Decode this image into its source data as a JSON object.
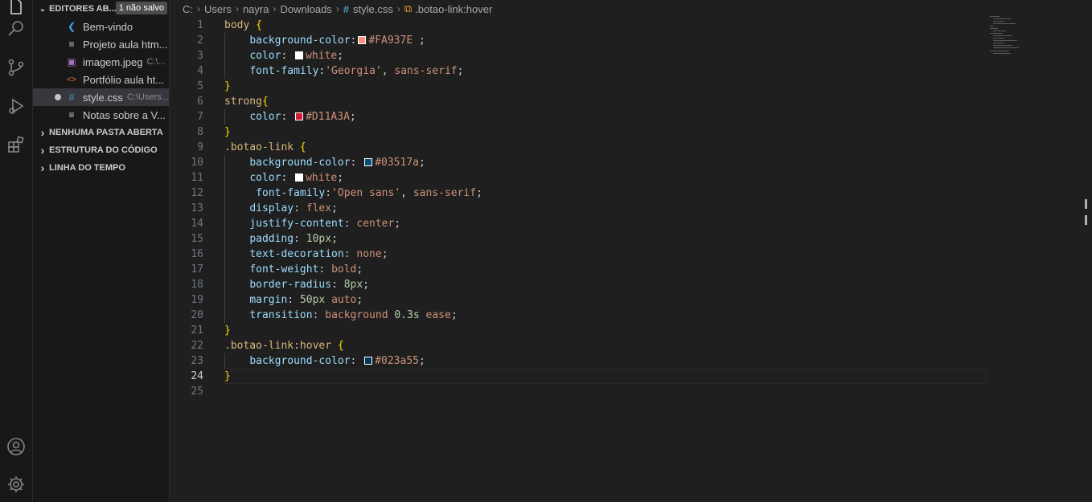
{
  "sidebar": {
    "open_editors": {
      "header": "EDITORES AB...",
      "unsaved_badge": "1 não salvo",
      "files": [
        {
          "name": "Bem-vindo",
          "desc": "",
          "icon": "vscode-icon"
        },
        {
          "name": "Projeto aula htm...",
          "desc": "",
          "icon": "file-lines-icon"
        },
        {
          "name": "imagem.jpeg",
          "desc": "C:\\...",
          "icon": "image-file-icon"
        },
        {
          "name": "Portfólio aula ht...",
          "desc": "",
          "icon": "html-file-icon"
        },
        {
          "name": "style.css",
          "desc": "C:\\Users...",
          "icon": "css-file-icon"
        },
        {
          "name": "Notas sobre a V...",
          "desc": "",
          "icon": "file-lines-icon"
        }
      ]
    },
    "sections": [
      {
        "label": "NENHUMA PASTA ABERTA"
      },
      {
        "label": "ESTRUTURA DO CÓDIGO"
      },
      {
        "label": "LINHA DO TEMPO"
      }
    ]
  },
  "breadcrumb": {
    "drive": "C:",
    "users": "Users",
    "user": "nayra",
    "folder": "Downloads",
    "file_icon": "#",
    "file": "style.css",
    "symbol": ".botao-link:hover"
  },
  "code": {
    "current_line": 24,
    "lines": [
      {
        "n": "1",
        "parts": [
          [
            "sel",
            "body"
          ],
          [
            "punct",
            " "
          ],
          [
            "brace",
            "{"
          ]
        ]
      },
      {
        "n": "2",
        "indent": true,
        "parts": [
          [
            "prop",
            "background-color"
          ],
          [
            "punct",
            ":"
          ],
          [
            "swatch",
            "#FA937E"
          ],
          [
            "val",
            "#FA937E"
          ],
          [
            "punct",
            " ;"
          ]
        ]
      },
      {
        "n": "3",
        "indent": true,
        "parts": [
          [
            "prop",
            "color"
          ],
          [
            "punct",
            ": "
          ],
          [
            "swatch",
            "#ffffff"
          ],
          [
            "val",
            "white"
          ],
          [
            "punct",
            ";"
          ]
        ]
      },
      {
        "n": "4",
        "indent": true,
        "parts": [
          [
            "prop",
            "font-family"
          ],
          [
            "punct",
            ":"
          ],
          [
            "val",
            "'Georgia'"
          ],
          [
            "punct",
            ", "
          ],
          [
            "val",
            "sans-serif"
          ],
          [
            "punct",
            ";"
          ]
        ]
      },
      {
        "n": "5",
        "parts": [
          [
            "brace",
            "}"
          ]
        ]
      },
      {
        "n": "6",
        "parts": [
          [
            "sel",
            "strong"
          ],
          [
            "brace",
            "{"
          ]
        ]
      },
      {
        "n": "7",
        "indent": true,
        "parts": [
          [
            "prop",
            "color"
          ],
          [
            "punct",
            ": "
          ],
          [
            "swatch",
            "#D11A3A"
          ],
          [
            "val",
            "#D11A3A"
          ],
          [
            "punct",
            ";"
          ]
        ]
      },
      {
        "n": "8",
        "parts": [
          [
            "brace",
            "}"
          ]
        ]
      },
      {
        "n": "9",
        "parts": [
          [
            "sel",
            ".botao-link"
          ],
          [
            "punct",
            " "
          ],
          [
            "brace",
            "{"
          ]
        ]
      },
      {
        "n": "10",
        "indent": true,
        "parts": [
          [
            "prop",
            "background-color"
          ],
          [
            "punct",
            ": "
          ],
          [
            "swatch",
            "#03517a"
          ],
          [
            "val",
            "#03517a"
          ],
          [
            "punct",
            ";"
          ]
        ]
      },
      {
        "n": "11",
        "indent": true,
        "parts": [
          [
            "prop",
            "color"
          ],
          [
            "punct",
            ": "
          ],
          [
            "swatch",
            "#ffffff"
          ],
          [
            "val",
            "white"
          ],
          [
            "punct",
            ";"
          ]
        ]
      },
      {
        "n": "12",
        "indent": true,
        "parts": [
          [
            "punct",
            " "
          ],
          [
            "prop",
            "font-family"
          ],
          [
            "punct",
            ":"
          ],
          [
            "val",
            "'Open sans'"
          ],
          [
            "punct",
            ", "
          ],
          [
            "val",
            "sans-serif"
          ],
          [
            "punct",
            ";"
          ]
        ]
      },
      {
        "n": "13",
        "indent": true,
        "parts": [
          [
            "prop",
            "display"
          ],
          [
            "punct",
            ": "
          ],
          [
            "val",
            "flex"
          ],
          [
            "punct",
            ";"
          ]
        ]
      },
      {
        "n": "14",
        "indent": true,
        "parts": [
          [
            "prop",
            "justify-content"
          ],
          [
            "punct",
            ": "
          ],
          [
            "val",
            "center"
          ],
          [
            "punct",
            ";"
          ]
        ]
      },
      {
        "n": "15",
        "indent": true,
        "parts": [
          [
            "prop",
            "padding"
          ],
          [
            "punct",
            ": "
          ],
          [
            "num",
            "10px"
          ],
          [
            "punct",
            ";"
          ]
        ]
      },
      {
        "n": "16",
        "indent": true,
        "parts": [
          [
            "prop",
            "text-decoration"
          ],
          [
            "punct",
            ": "
          ],
          [
            "val",
            "none"
          ],
          [
            "punct",
            ";"
          ]
        ]
      },
      {
        "n": "17",
        "indent": true,
        "parts": [
          [
            "prop",
            "font-weight"
          ],
          [
            "punct",
            ": "
          ],
          [
            "val",
            "bold"
          ],
          [
            "punct",
            ";"
          ]
        ]
      },
      {
        "n": "18",
        "indent": true,
        "parts": [
          [
            "prop",
            "border-radius"
          ],
          [
            "punct",
            ": "
          ],
          [
            "num",
            "8px"
          ],
          [
            "punct",
            ";"
          ]
        ]
      },
      {
        "n": "19",
        "indent": true,
        "parts": [
          [
            "prop",
            "margin"
          ],
          [
            "punct",
            ": "
          ],
          [
            "num",
            "50px"
          ],
          [
            "punct",
            " "
          ],
          [
            "val",
            "auto"
          ],
          [
            "punct",
            ";"
          ]
        ]
      },
      {
        "n": "20",
        "indent": true,
        "parts": [
          [
            "prop",
            "transition"
          ],
          [
            "punct",
            ": "
          ],
          [
            "kw",
            "background"
          ],
          [
            "punct",
            " "
          ],
          [
            "num",
            "0.3s"
          ],
          [
            "punct",
            " "
          ],
          [
            "val",
            "ease"
          ],
          [
            "punct",
            ";"
          ]
        ]
      },
      {
        "n": "21",
        "parts": [
          [
            "brace",
            "}"
          ]
        ]
      },
      {
        "n": "22",
        "parts": [
          [
            "sel",
            ".botao-link:hover"
          ],
          [
            "punct",
            " "
          ],
          [
            "brace",
            "{"
          ]
        ]
      },
      {
        "n": "23",
        "indent": true,
        "parts": [
          [
            "prop",
            "background-color"
          ],
          [
            "punct",
            ": "
          ],
          [
            "swatch",
            "#023a55"
          ],
          [
            "val",
            "#023a55"
          ],
          [
            "punct",
            ";"
          ]
        ]
      },
      {
        "n": "24",
        "parts": [
          [
            "brace",
            "}"
          ]
        ]
      },
      {
        "n": "25",
        "parts": []
      }
    ]
  },
  "colors": {
    "accent": "#0078d4",
    "editor_bg": "#1f1f1f",
    "sidebar_bg": "#181818"
  }
}
